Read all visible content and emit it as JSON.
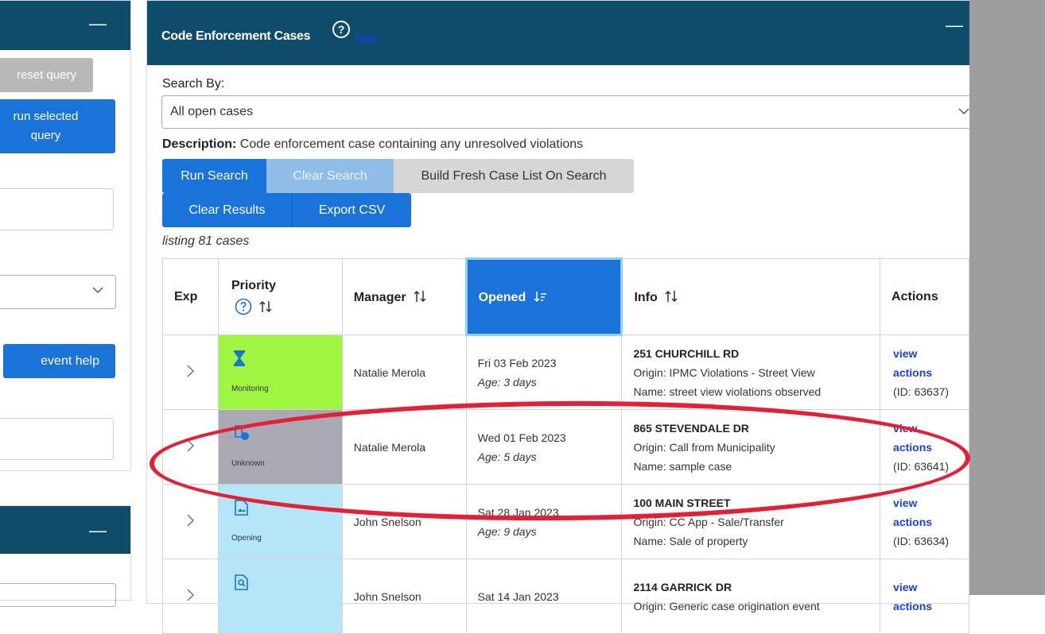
{
  "left_panel": {
    "reset_query": "reset query",
    "run_selected_query": "run selected query",
    "event_help": "event help",
    "minimize": "—"
  },
  "main": {
    "title": "Code Enforcement Cases",
    "help_link": "help",
    "help_icon_glyph": "?",
    "minimize": "—",
    "search_by_label": "Search By:",
    "selected_query": "All open cases",
    "description_label": "Description:",
    "description_text": "Code enforcement case containing any unresolved violations",
    "buttons": {
      "run_search": "Run Search",
      "clear_search": "Clear Search",
      "build_fresh": "Build Fresh Case List On Search",
      "clear_results": "Clear Results",
      "export_csv": "Export CSV"
    },
    "listing": "listing 81 cases",
    "columns": {
      "exp": "Exp",
      "priority": "Priority",
      "manager": "Manager",
      "opened": "Opened",
      "info": "Info",
      "actions": "Actions"
    },
    "rows": [
      {
        "priority_label": "Monitoring",
        "priority_color": "#9ef542",
        "priority_icon": "hourglass-icon",
        "manager": "Natalie Merola",
        "opened": "Fri 03 Feb 2023",
        "age": "Age: 3 days",
        "address": "251 CHURCHILL RD",
        "origin": "Origin: IPMC Violations - Street View",
        "name": "Name: street view violations observed",
        "view": "view",
        "actions": "actions",
        "id": "(ID: 63637)"
      },
      {
        "priority_label": "Unknown",
        "priority_color": "#a9a9b3",
        "priority_icon": "document-clock-icon",
        "manager": "Natalie Merola",
        "opened": "Wed 01 Feb 2023",
        "age": "Age: 5 days",
        "address": "865 STEVENDALE DR",
        "origin": "Origin: Call from Municipality",
        "name": "Name: sample case",
        "view": "view",
        "actions": "actions",
        "id": "(ID: 63641)"
      },
      {
        "priority_label": "Opening",
        "priority_color": "#b4e6f8",
        "priority_icon": "document-image-icon",
        "manager": "John Snelson",
        "opened": "Sat 28 Jan 2023",
        "age": "Age: 9 days",
        "address": "100 MAIN STREET",
        "origin": "Origin: CC App - Sale/Transfer",
        "name": "Name: Sale of property",
        "view": "view",
        "actions": "actions",
        "id": "(ID: 63634)"
      },
      {
        "priority_label": "",
        "priority_color": "#b4e6f8",
        "priority_icon": "document-search-icon",
        "manager": "John Snelson",
        "opened": "Sat 14 Jan 2023",
        "age": "",
        "address": "2114 GARRICK DR",
        "origin": "Origin: Generic case origination event",
        "name": "",
        "view": "view",
        "actions": "actions",
        "id": ""
      }
    ]
  }
}
